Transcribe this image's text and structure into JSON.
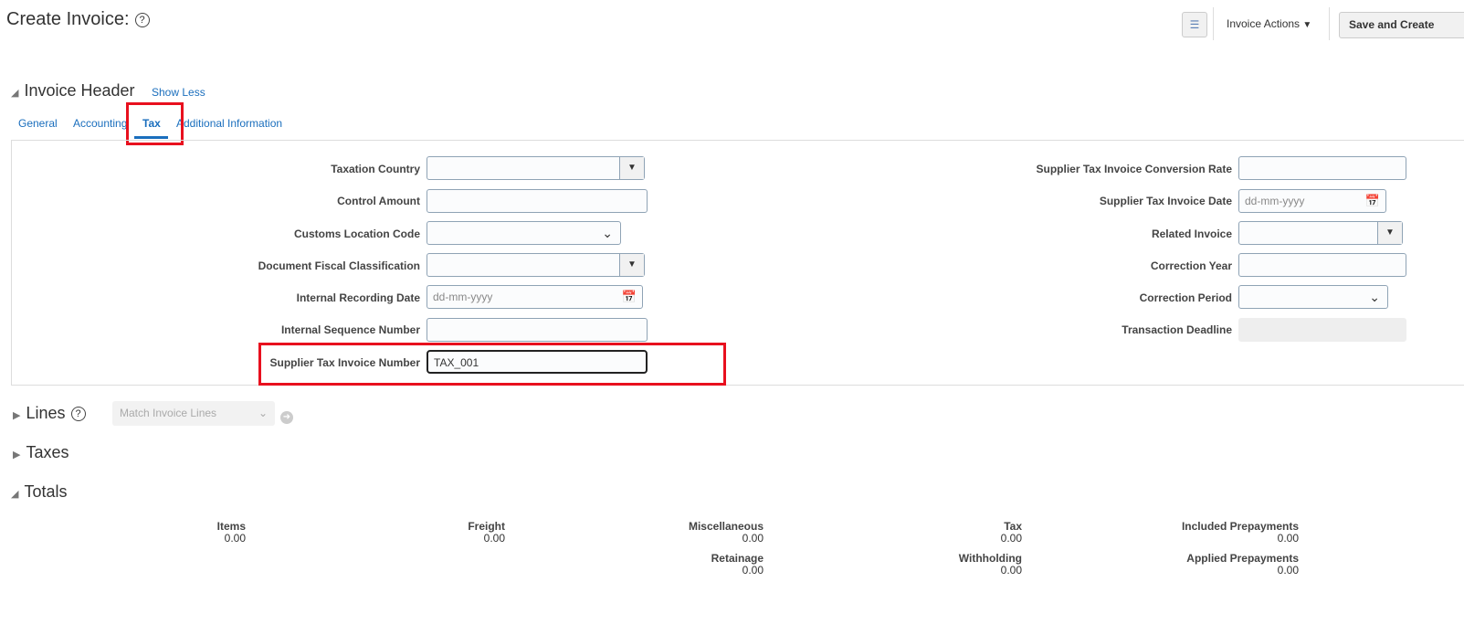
{
  "page": {
    "title": "Create Invoice:"
  },
  "toolbar": {
    "actions_label": "Invoice Actions",
    "save_label": "Save and Create"
  },
  "header": {
    "title": "Invoice Header",
    "toggle_label": "Show Less",
    "tabs": [
      {
        "label": "General"
      },
      {
        "label": "Accounting"
      },
      {
        "label": "Tax"
      },
      {
        "label": "Additional Information"
      }
    ]
  },
  "form_left": [
    {
      "label": "Taxation Country",
      "value": ""
    },
    {
      "label": "Control Amount",
      "value": ""
    },
    {
      "label": "Customs Location Code",
      "value": ""
    },
    {
      "label": "Document Fiscal Classification",
      "value": ""
    },
    {
      "label": "Internal Recording Date",
      "placeholder": "dd-mm-yyyy"
    },
    {
      "label": "Internal Sequence Number",
      "value": ""
    },
    {
      "label": "Supplier Tax Invoice Number",
      "value": "TAX_001"
    }
  ],
  "form_right": [
    {
      "label": "Supplier Tax Invoice Conversion Rate",
      "value": ""
    },
    {
      "label": "Supplier Tax Invoice Date",
      "placeholder": "dd-mm-yyyy"
    },
    {
      "label": "Related Invoice",
      "value": ""
    },
    {
      "label": "Correction Year",
      "value": ""
    },
    {
      "label": "Correction Period",
      "value": ""
    },
    {
      "label": "Transaction Deadline",
      "value": ""
    }
  ],
  "lines": {
    "title": "Lines",
    "match_placeholder": "Match Invoice Lines"
  },
  "taxes": {
    "title": "Taxes"
  },
  "totals": {
    "title": "Totals",
    "items": [
      {
        "label": "Items",
        "value": "0.00"
      },
      {
        "label": "Freight",
        "value": "0.00"
      },
      {
        "label": "Miscellaneous",
        "value": "0.00"
      },
      {
        "label": "Tax",
        "value": "0.00"
      },
      {
        "label": "Included Prepayments",
        "value": "0.00"
      },
      {
        "label": "Retainage",
        "value": "0.00"
      },
      {
        "label": "Withholding",
        "value": "0.00"
      },
      {
        "label": "Applied Prepayments",
        "value": "0.00"
      }
    ]
  }
}
